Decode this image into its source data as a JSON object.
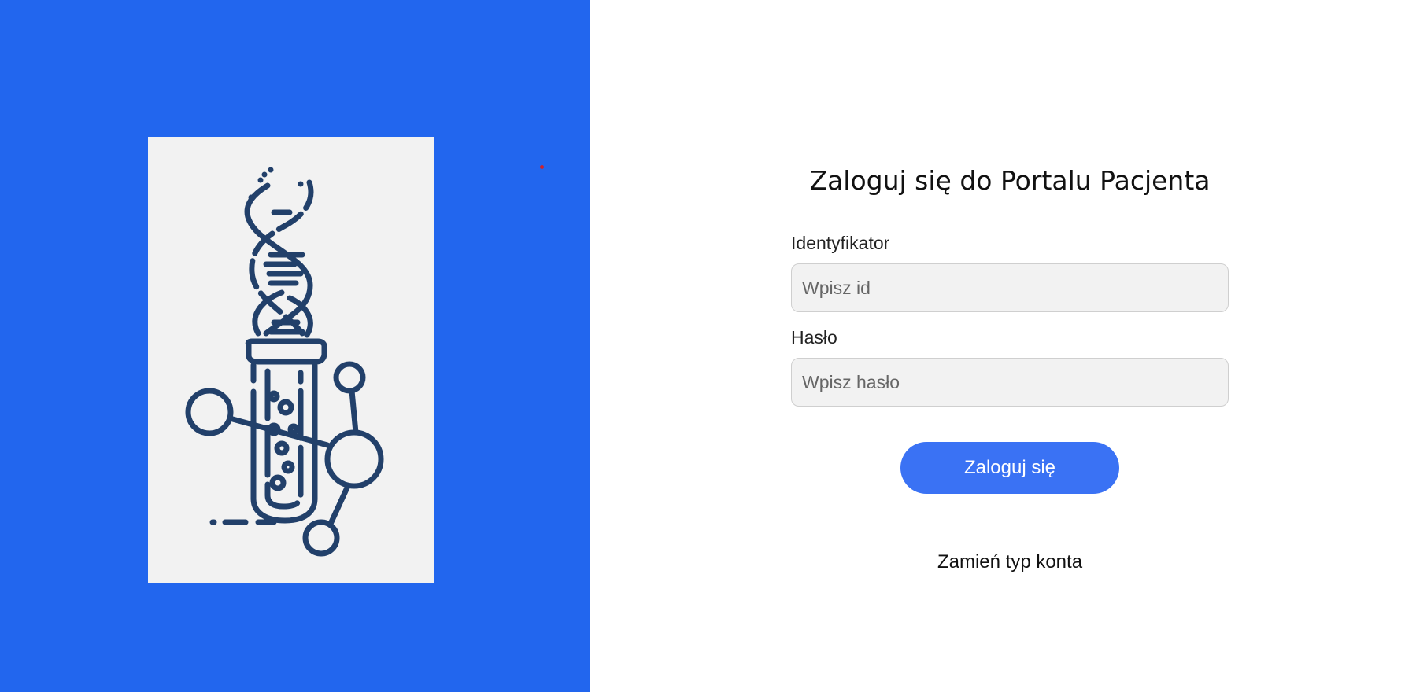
{
  "login": {
    "title": "Zaloguj się do Portalu Pacjenta",
    "id_label": "Identyfikator",
    "id_placeholder": "Wpisz id",
    "id_value": "",
    "password_label": "Hasło",
    "password_placeholder": "Wpisz hasło",
    "password_value": "",
    "submit_label": "Zaloguj się",
    "switch_account_label": "Zamień typ konta"
  },
  "illustration": {
    "icon": "dna-test-tube-molecule-icon"
  },
  "colors": {
    "left_panel_bg": "#2266ee",
    "card_bg": "#f2f2f2",
    "icon_stroke": "#22406a",
    "button_bg": "#3a72f4",
    "input_bg": "#f2f2f2"
  }
}
